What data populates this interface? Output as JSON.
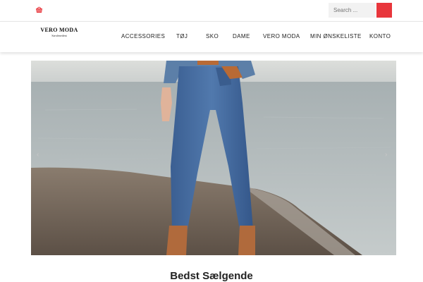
{
  "header": {
    "cart_icon": "basket-icon",
    "search_placeholder": "Search ...",
    "search_button_color": "#e8363c"
  },
  "logo": {
    "brand": "VERO MODA",
    "tagline": "Stavdenedent"
  },
  "nav": {
    "items": [
      {
        "label": "ACCESSORIES"
      },
      {
        "label": "TØJ"
      },
      {
        "label": "SKO"
      },
      {
        "label": "DAME"
      },
      {
        "label": "VERO MODA"
      },
      {
        "label": "MIN ØNSKELISTE"
      },
      {
        "label": "KONTO"
      }
    ]
  },
  "hero": {
    "image": "model-in-blue-jeans-by-sea",
    "prev_icon": "chevron-left-icon",
    "next_icon": "chevron-right-icon"
  },
  "section": {
    "title": "Bedst Sælgende"
  }
}
